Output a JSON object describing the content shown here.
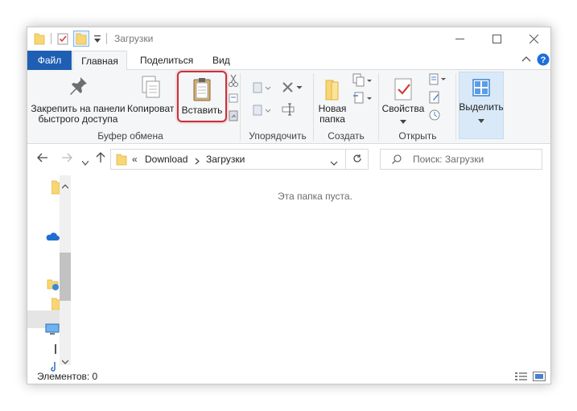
{
  "window": {
    "title": "Загрузки"
  },
  "tabs": {
    "file": "Файл",
    "home": "Главная",
    "share": "Поделиться",
    "view": "Вид"
  },
  "ribbon": {
    "pin_label_line1": "Закрепить на панели",
    "pin_label_line2": "быстрого доступа",
    "copy_label": "Копировать",
    "paste_label": "Вставить",
    "clipboard_group": "Буфер обмена",
    "organize_group": "Упорядочить",
    "new_folder_line1": "Новая",
    "new_folder_line2": "папка",
    "create_group": "Создать",
    "properties_label": "Свойства",
    "open_group": "Открыть",
    "select_label": "Выделить"
  },
  "address": {
    "overflow": "«",
    "crumb1": "Download",
    "crumb2": "Загрузки",
    "search_placeholder": "Поиск: Загрузки"
  },
  "content": {
    "empty_message": "Эта папка пуста."
  },
  "status": {
    "items": "Элементов: 0"
  },
  "colors": {
    "file_tab": "#1e5fb4",
    "highlight": "#c8323c",
    "selected": "#d9e9f8",
    "help": "#1e6fd9"
  }
}
